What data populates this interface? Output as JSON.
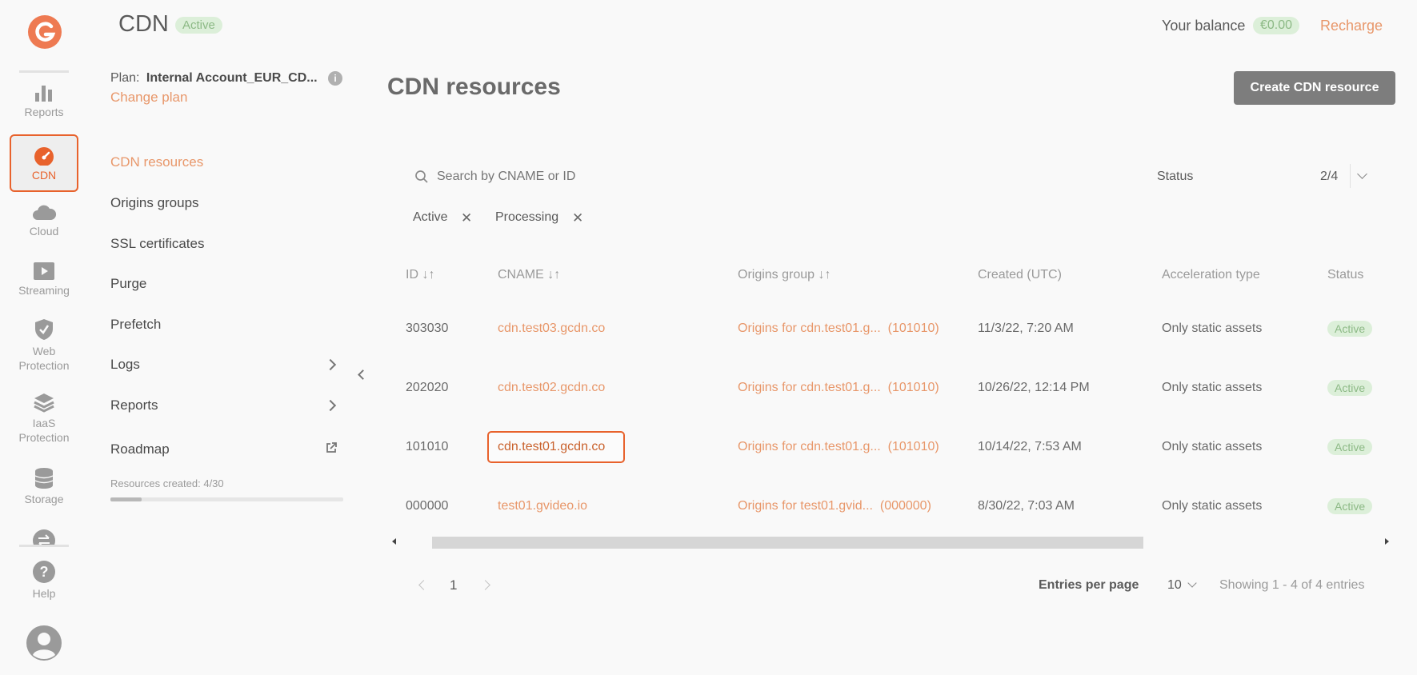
{
  "header": {
    "title": "CDN",
    "status_badge": "Active",
    "balance_label": "Your balance",
    "balance_value": "€0.00",
    "recharge_label": "Recharge"
  },
  "rail": {
    "items": [
      {
        "label": "Reports",
        "icon": "bar-chart-icon"
      },
      {
        "label": "CDN",
        "icon": "speedometer-icon"
      },
      {
        "label": "Cloud",
        "icon": "cloud-icon"
      },
      {
        "label": "Streaming",
        "icon": "play-icon"
      },
      {
        "label_line1": "Web",
        "label_line2": "Protection",
        "icon": "shield-icon"
      },
      {
        "label_line1": "IaaS",
        "label_line2": "Protection",
        "icon": "layers-icon"
      },
      {
        "label": "Storage",
        "icon": "database-icon"
      },
      {
        "label": "Help",
        "icon": "help-icon"
      }
    ]
  },
  "plan": {
    "label": "Plan:",
    "name": "Internal Account_EUR_CD...",
    "change_label": "Change plan"
  },
  "sidebar": {
    "items": [
      {
        "label": "CDN resources"
      },
      {
        "label": "Origins groups"
      },
      {
        "label": "SSL certificates"
      },
      {
        "label": "Purge"
      },
      {
        "label": "Prefetch"
      },
      {
        "label": "Logs"
      },
      {
        "label": "Reports"
      },
      {
        "label": "Roadmap"
      }
    ],
    "resources_created": "Resources created: 4/30",
    "resources_progress": 0.133
  },
  "main": {
    "title": "CDN resources",
    "create_button": "Create CDN resource",
    "search_placeholder": "Search by CNAME or ID",
    "status_filter_label": "Status",
    "status_filter_value": "2/4",
    "chips": [
      "Active",
      "Processing"
    ],
    "columns": [
      "ID ↓↑",
      "CNAME ↓↑",
      "Origins group ↓↑",
      "Created (UTC)",
      "Acceleration type",
      "Status"
    ],
    "rows": [
      {
        "id": "303030",
        "cname": "cdn.test03.gcdn.co",
        "origin": "Origins for cdn.test01.g...",
        "origin_id": "(101010)",
        "created": "11/3/22, 7:20 AM",
        "accel": "Only static assets",
        "status": "Active"
      },
      {
        "id": "202020",
        "cname": "cdn.test02.gcdn.co",
        "origin": "Origins for cdn.test01.g...",
        "origin_id": "(101010)",
        "created": "10/26/22, 12:14 PM",
        "accel": "Only static assets",
        "status": "Active"
      },
      {
        "id": "101010",
        "cname": "cdn.test01.gcdn.co",
        "origin": "Origins for cdn.test01.g...",
        "origin_id": "(101010)",
        "created": "10/14/22, 7:53 AM",
        "accel": "Only static assets",
        "status": "Active"
      },
      {
        "id": "000000",
        "cname": "test01.gvideo.io",
        "origin": "Origins for test01.gvid...",
        "origin_id": "(000000)",
        "created": "8/30/22, 7:03 AM",
        "accel": "Only static assets",
        "status": "Active"
      }
    ],
    "pagination": {
      "page": "1",
      "entries_label": "Entries per page",
      "entries_value": "10",
      "showing": "Showing 1 - 4 of 4 entries"
    }
  },
  "colors": {
    "accent": "#e8976a",
    "accent_strong": "#e8622c",
    "button_bg": "#7d7d7d",
    "badge_bg": "#dcefd9"
  }
}
